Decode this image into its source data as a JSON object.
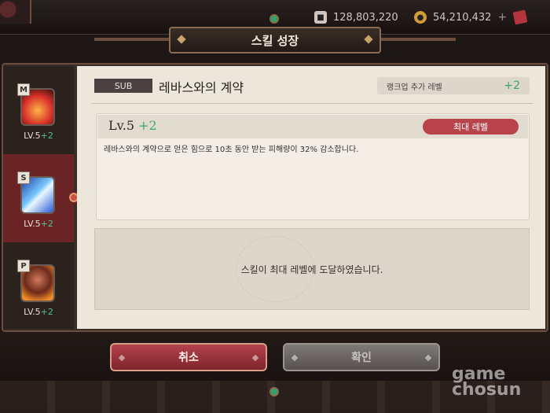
{
  "header": {
    "title": "스킬 성장",
    "currency1": {
      "icon": "stamina-icon",
      "value": "128,803,220"
    },
    "currency2": {
      "icon": "gold-coin-icon",
      "value": "54,210,432",
      "plus": "+"
    }
  },
  "skill_list": [
    {
      "type": "M",
      "level": "LV.5",
      "bonus": "+2",
      "active": false
    },
    {
      "type": "S",
      "level": "LV.5",
      "bonus": "+2",
      "active": true
    },
    {
      "type": "P",
      "level": "LV.5",
      "bonus": "+2",
      "active": false
    }
  ],
  "detail": {
    "badge": "SUB",
    "skill_name": "레바스와의 계약",
    "rankup_label": "랭크업 추가 레벨",
    "rankup_value": "+2",
    "level_text": "Lv.5",
    "level_bonus": "+2",
    "max_level_pill": "최대 레벨",
    "description": "레바스와의 계약으로 얻은 힘으로 10초 동안 받는 피해량이 32% 감소합니다.",
    "max_reached_message": "스킬이 최대 레벨에 도달하였습니다."
  },
  "buttons": {
    "cancel": "취소",
    "confirm": "확인"
  },
  "watermark": {
    "line1": "game",
    "line2": "chosun"
  },
  "colors": {
    "accent_red": "#b8434b",
    "bonus_green": "#3ea56e"
  }
}
